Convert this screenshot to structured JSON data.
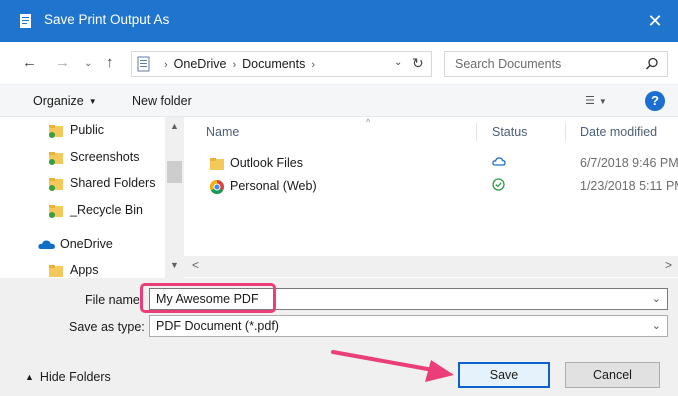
{
  "window": {
    "title": "Save Print Output As"
  },
  "address": {
    "crumbs": [
      "OneDrive",
      "Documents"
    ],
    "search_placeholder": "Search Documents"
  },
  "toolbar": {
    "organize_label": "Organize",
    "new_folder_label": "New folder"
  },
  "sidebar": {
    "items": [
      {
        "label": "Public",
        "icon": "user-folder-icon"
      },
      {
        "label": "Screenshots",
        "icon": "user-folder-icon"
      },
      {
        "label": "Shared Folders",
        "icon": "user-folder-icon"
      },
      {
        "label": "_Recycle Bin",
        "icon": "user-folder-icon"
      },
      {
        "label": "OneDrive",
        "icon": "onedrive-cloud-icon"
      },
      {
        "label": "Apps",
        "icon": "folder-icon"
      }
    ]
  },
  "filelist": {
    "columns": [
      "Name",
      "Status",
      "Date modified"
    ],
    "rows": [
      {
        "name": "Outlook Files",
        "icon": "folder-icon",
        "status": "cloud-icon",
        "date": "6/7/2018 9:46 PM"
      },
      {
        "name": "Personal (Web)",
        "icon": "chrome-shortcut-icon",
        "status": "synced-check-icon",
        "date": "1/23/2018 5:11 PM"
      }
    ]
  },
  "form": {
    "file_name_label": "File name:",
    "file_name_value": "My Awesome PDF",
    "save_as_type_label": "Save as type:",
    "save_as_type_value": "PDF Document (*.pdf)"
  },
  "footer": {
    "hide_folders_label": "Hide Folders",
    "save_label": "Save",
    "cancel_label": "Cancel"
  },
  "colors": {
    "titlebar": "#1f74cd",
    "highlight": "#ea3d79",
    "accent": "#0a64c8"
  }
}
